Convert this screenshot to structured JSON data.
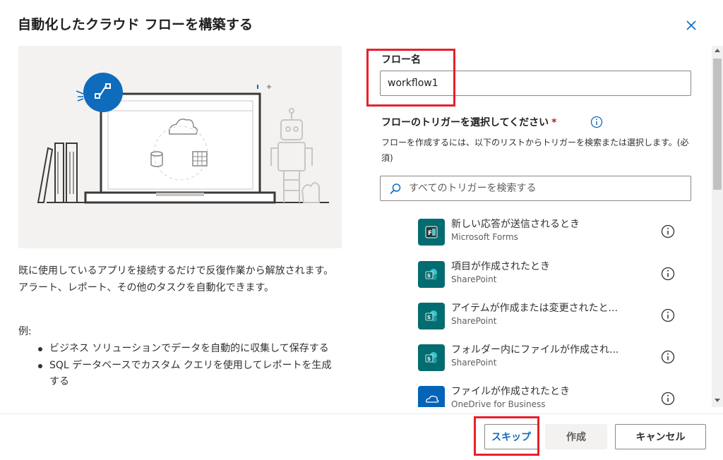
{
  "dialog": {
    "title": "自動化したクラウド フローを構築する",
    "close_icon": "close-icon"
  },
  "left": {
    "description": "既に使用しているアプリを接続するだけで反復作業から解放されます。アラート、レポート、その他のタスクを自動化できます。",
    "example_label": "例:",
    "examples": [
      "ビジネス ソリューションでデータを自動的に収集して保存する",
      "SQL データベースでカスタム クエリを使用してレポートを生成する"
    ]
  },
  "form": {
    "flow_name_label": "フロー名",
    "flow_name_value": "workflow1",
    "trigger_label": "フローのトリガーを選択してください",
    "required_mark": "*",
    "trigger_help": "フローを作成するには、以下のリストからトリガーを検索または選択します。(必須)",
    "search_placeholder": "すべてのトリガーを検索する"
  },
  "triggers": [
    {
      "name": "新しい応答が送信されるとき",
      "connector": "Microsoft Forms",
      "icon": "forms-icon",
      "color": "#036c70"
    },
    {
      "name": "項目が作成されたとき",
      "connector": "SharePoint",
      "icon": "sharepoint-icon",
      "color": "#036c70"
    },
    {
      "name": "アイテムが作成または変更されたと...",
      "connector": "SharePoint",
      "icon": "sharepoint-icon",
      "color": "#036c70"
    },
    {
      "name": "フォルダー内にファイルが作成され...",
      "connector": "SharePoint",
      "icon": "sharepoint-icon",
      "color": "#036c70"
    },
    {
      "name": "ファイルが作成されたとき",
      "connector": "OneDrive for Business",
      "icon": "onedrive-icon",
      "color": "#0364b8"
    }
  ],
  "footer": {
    "skip_label": "スキップ",
    "create_label": "作成",
    "cancel_label": "キャンセル"
  },
  "colors": {
    "accent": "#0f6cbd",
    "highlight": "#e8202a",
    "illustration_bg": "#f3f2f1"
  }
}
